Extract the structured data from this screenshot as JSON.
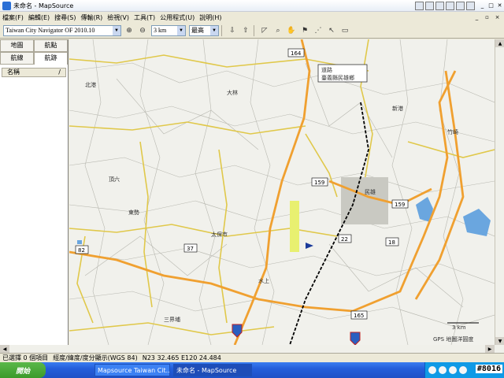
{
  "window": {
    "title": "未命名 - MapSource"
  },
  "menu": [
    "檔案(F)",
    "編輯(E)",
    "搜尋(S)",
    "傳輸(R)",
    "檢視(V)",
    "工具(T)",
    "公用程式(U)",
    "說明(H)"
  ],
  "toolbar": {
    "product": "Taiwan City Navigator OF 2010.10",
    "zoom": "3 km",
    "detail": "最高"
  },
  "left_panel": {
    "tabs": [
      "地圖",
      "航點",
      "航線",
      "航跡"
    ],
    "column_name": "名稱",
    "column_sort": "/"
  },
  "map": {
    "callout_label": "道路",
    "callout_value": "臺義縣民雄鄉",
    "labels": [
      "民雄",
      "太保市",
      "東勢",
      "水上",
      "新港",
      "三界埔",
      "頂六",
      "北港",
      "大林",
      "竹崎"
    ],
    "route_shields": [
      "164",
      "159",
      "159",
      "37",
      "22",
      "18",
      "82",
      "165"
    ],
    "scale": "3 km",
    "copyright": "GPS 地圖洋圓度",
    "colors": {
      "background": "#f1f1ec",
      "major_road": "#f0a030",
      "minor_road": "#e8d060",
      "water": "#6aa6df",
      "rail": "#000000"
    }
  },
  "status": {
    "selection": "已選擇 0 個項目",
    "datum": "經度/緯度/度分顯示(WGS 84)",
    "coords": "N23 32.465 E120 24.484"
  },
  "taskbar": {
    "start": "開始",
    "tasks": [
      "Mapsource Taiwan Cit...",
      "未命名 - MapSource"
    ]
  },
  "stamp": "#8016"
}
